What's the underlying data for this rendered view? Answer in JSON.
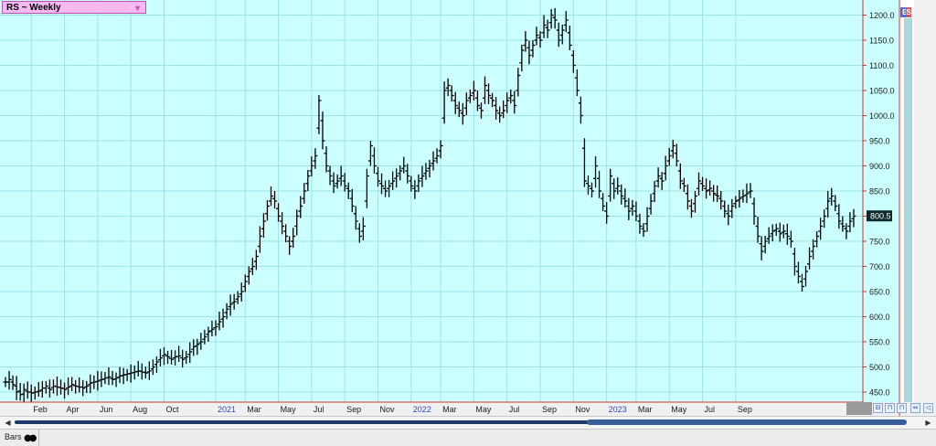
{
  "header": {
    "symbol_label": "RS ~ Weekly",
    "dropdown_glyph": "▼",
    "badge_b": "B",
    "badge_s": "S"
  },
  "status_bar": {
    "chart_style_label": "Bars",
    "style_icon": "glasses-icon"
  },
  "scroll": {
    "left_glyph": "◀",
    "right_glyph": "▶",
    "left_small": "‹",
    "right_small": "›"
  },
  "nav_buttons": [
    "⊟",
    "⊓",
    "⊓",
    "⇔",
    "◁",
    "▷",
    "⇄"
  ],
  "colors": {
    "background": "#ccffff",
    "grid": "#9be3e8",
    "bars": "#000000",
    "axis_line": "#e0302a",
    "last_price_bg": "#0e2a2a",
    "last_price_fg": "#ffffff",
    "time_axis_text": "#1a1a1a",
    "year_text": "#2a48d0"
  },
  "chart_data": {
    "type": "bar",
    "title": "RS ~ Weekly",
    "bar_style": "OHLC",
    "ylim": [
      430,
      1230
    ],
    "y_ticks": [
      450,
      500,
      550,
      600,
      650,
      700,
      750,
      800,
      850,
      900,
      950,
      1000,
      1050,
      1100,
      1150,
      1200
    ],
    "y_tick_labels": [
      "450.0",
      "500.0",
      "550.0",
      "600.0",
      "650.0",
      "700.0",
      "750.0",
      "800.0",
      "850.0",
      "900.0",
      "950.0",
      "1000.0",
      "1050.0",
      "1100.0",
      "1150.0",
      "1200.0"
    ],
    "last_price": 800.5,
    "last_price_label": "800.5",
    "x_labels": [
      {
        "label": "Feb",
        "x": 7,
        "year": false
      },
      {
        "label": "Apr",
        "x": 16,
        "year": false
      },
      {
        "label": "Jun",
        "x": 25,
        "year": false
      },
      {
        "label": "Aug",
        "x": 34,
        "year": false
      },
      {
        "label": "Oct",
        "x": 43,
        "year": false
      },
      {
        "label": "2021",
        "x": 57,
        "year": true
      },
      {
        "label": "Mar",
        "x": 65,
        "year": false
      },
      {
        "label": "May",
        "x": 74,
        "year": false
      },
      {
        "label": "Jul",
        "x": 83,
        "year": false
      },
      {
        "label": "Sep",
        "x": 92,
        "year": false
      },
      {
        "label": "Nov",
        "x": 101,
        "year": false
      },
      {
        "label": "2022",
        "x": 110,
        "year": true
      },
      {
        "label": "Mar",
        "x": 118,
        "year": false
      },
      {
        "label": "May",
        "x": 127,
        "year": false
      },
      {
        "label": "Jul",
        "x": 136,
        "year": false
      },
      {
        "label": "Sep",
        "x": 145,
        "year": false
      },
      {
        "label": "Nov",
        "x": 154,
        "year": false
      },
      {
        "label": "2023",
        "x": 163,
        "year": true
      },
      {
        "label": "Mar",
        "x": 171,
        "year": false
      },
      {
        "label": "May",
        "x": 180,
        "year": false
      },
      {
        "label": "Jul",
        "x": 189,
        "year": false
      },
      {
        "label": "Sep",
        "x": 198,
        "year": false
      }
    ],
    "close": [
      470,
      475,
      465,
      450,
      445,
      455,
      450,
      448,
      450,
      452,
      458,
      462,
      455,
      462,
      460,
      458,
      455,
      460,
      465,
      462,
      460,
      458,
      462,
      468,
      470,
      472,
      475,
      478,
      480,
      475,
      478,
      482,
      484,
      486,
      488,
      490,
      492,
      490,
      488,
      492,
      500,
      510,
      518,
      525,
      520,
      515,
      520,
      522,
      515,
      520,
      530,
      540,
      545,
      550,
      560,
      570,
      575,
      580,
      590,
      600,
      615,
      625,
      630,
      640,
      650,
      670,
      690,
      700,
      720,
      760,
      790,
      820,
      840,
      830,
      800,
      780,
      760,
      740,
      760,
      800,
      820,
      850,
      880,
      900,
      920,
      1030,
      950,
      900,
      880,
      860,
      870,
      880,
      860,
      850,
      820,
      790,
      760,
      780,
      880,
      940,
      900,
      870,
      860,
      850,
      860,
      870,
      880,
      890,
      900,
      880,
      860,
      850,
      870,
      880,
      890,
      900,
      910,
      920,
      940,
      1050,
      1060,
      1040,
      1020,
      1010,
      1000,
      1030,
      1040,
      1050,
      1020,
      1010,
      1060,
      1040,
      1030,
      1010,
      1000,
      1010,
      1030,
      1040,
      1020,
      1080,
      1130,
      1150,
      1120,
      1140,
      1160,
      1150,
      1180,
      1170,
      1200,
      1190,
      1150,
      1170,
      1190,
      1140,
      1100,
      1050,
      1000,
      870,
      860,
      850,
      900,
      850,
      820,
      800,
      880,
      850,
      860,
      840,
      830,
      810,
      820,
      800,
      780,
      770,
      800,
      830,
      860,
      880,
      870,
      900,
      920,
      940,
      910,
      870,
      860,
      830,
      810,
      840,
      870,
      860,
      850,
      855,
      845,
      840,
      830,
      810,
      800,
      820,
      830,
      835,
      840,
      845,
      850,
      800,
      760,
      730,
      750,
      760,
      770,
      775,
      765,
      770,
      760,
      750,
      700,
      680,
      660,
      690,
      720,
      740,
      760,
      780,
      800,
      830,
      840,
      820,
      790,
      780,
      770,
      790,
      800
    ],
    "open": [
      470,
      470,
      470,
      462,
      452,
      446,
      452,
      450,
      449,
      451,
      454,
      458,
      458,
      459,
      461,
      459,
      457,
      458,
      462,
      463,
      461,
      460,
      460,
      465,
      469,
      471,
      474,
      476,
      479,
      477,
      476,
      480,
      483,
      485,
      487,
      489,
      491,
      491,
      489,
      490,
      496,
      505,
      514,
      522,
      522,
      517,
      518,
      521,
      518,
      518,
      525,
      535,
      542,
      548,
      555,
      565,
      572,
      578,
      585,
      595,
      608,
      620,
      628,
      635,
      645,
      660,
      680,
      695,
      710,
      740,
      775,
      805,
      830,
      835,
      815,
      790,
      770,
      750,
      750,
      780,
      810,
      835,
      865,
      890,
      910,
      975,
      990,
      925,
      890,
      870,
      865,
      875,
      870,
      855,
      835,
      805,
      775,
      770,
      830,
      910,
      920,
      885,
      865,
      855,
      855,
      865,
      875,
      885,
      895,
      890,
      870,
      855,
      860,
      875,
      885,
      895,
      905,
      915,
      930,
      995,
      1055,
      1050,
      1030,
      1015,
      1005,
      1015,
      1035,
      1045,
      1035,
      1015,
      1035,
      1050,
      1035,
      1020,
      1005,
      1005,
      1020,
      1035,
      1030,
      1050,
      1105,
      1140,
      1135,
      1130,
      1150,
      1155,
      1165,
      1175,
      1185,
      1195,
      1170,
      1160,
      1180,
      1165,
      1120,
      1075,
      1025,
      935,
      865,
      855,
      875,
      875,
      835,
      810,
      840,
      865,
      855,
      850,
      835,
      820,
      815,
      810,
      790,
      775,
      785,
      815,
      845,
      870,
      875,
      885,
      910,
      930,
      925,
      890,
      865,
      845,
      820,
      825,
      855,
      865,
      855,
      852,
      850,
      842,
      835,
      820,
      805,
      810,
      825,
      832,
      838,
      842,
      848,
      825,
      780,
      745,
      740,
      755,
      765,
      772,
      770,
      768,
      765,
      755,
      725,
      690,
      670,
      675,
      705,
      730,
      750,
      770,
      790,
      815,
      835,
      830,
      805,
      785,
      775,
      780,
      795
    ]
  }
}
